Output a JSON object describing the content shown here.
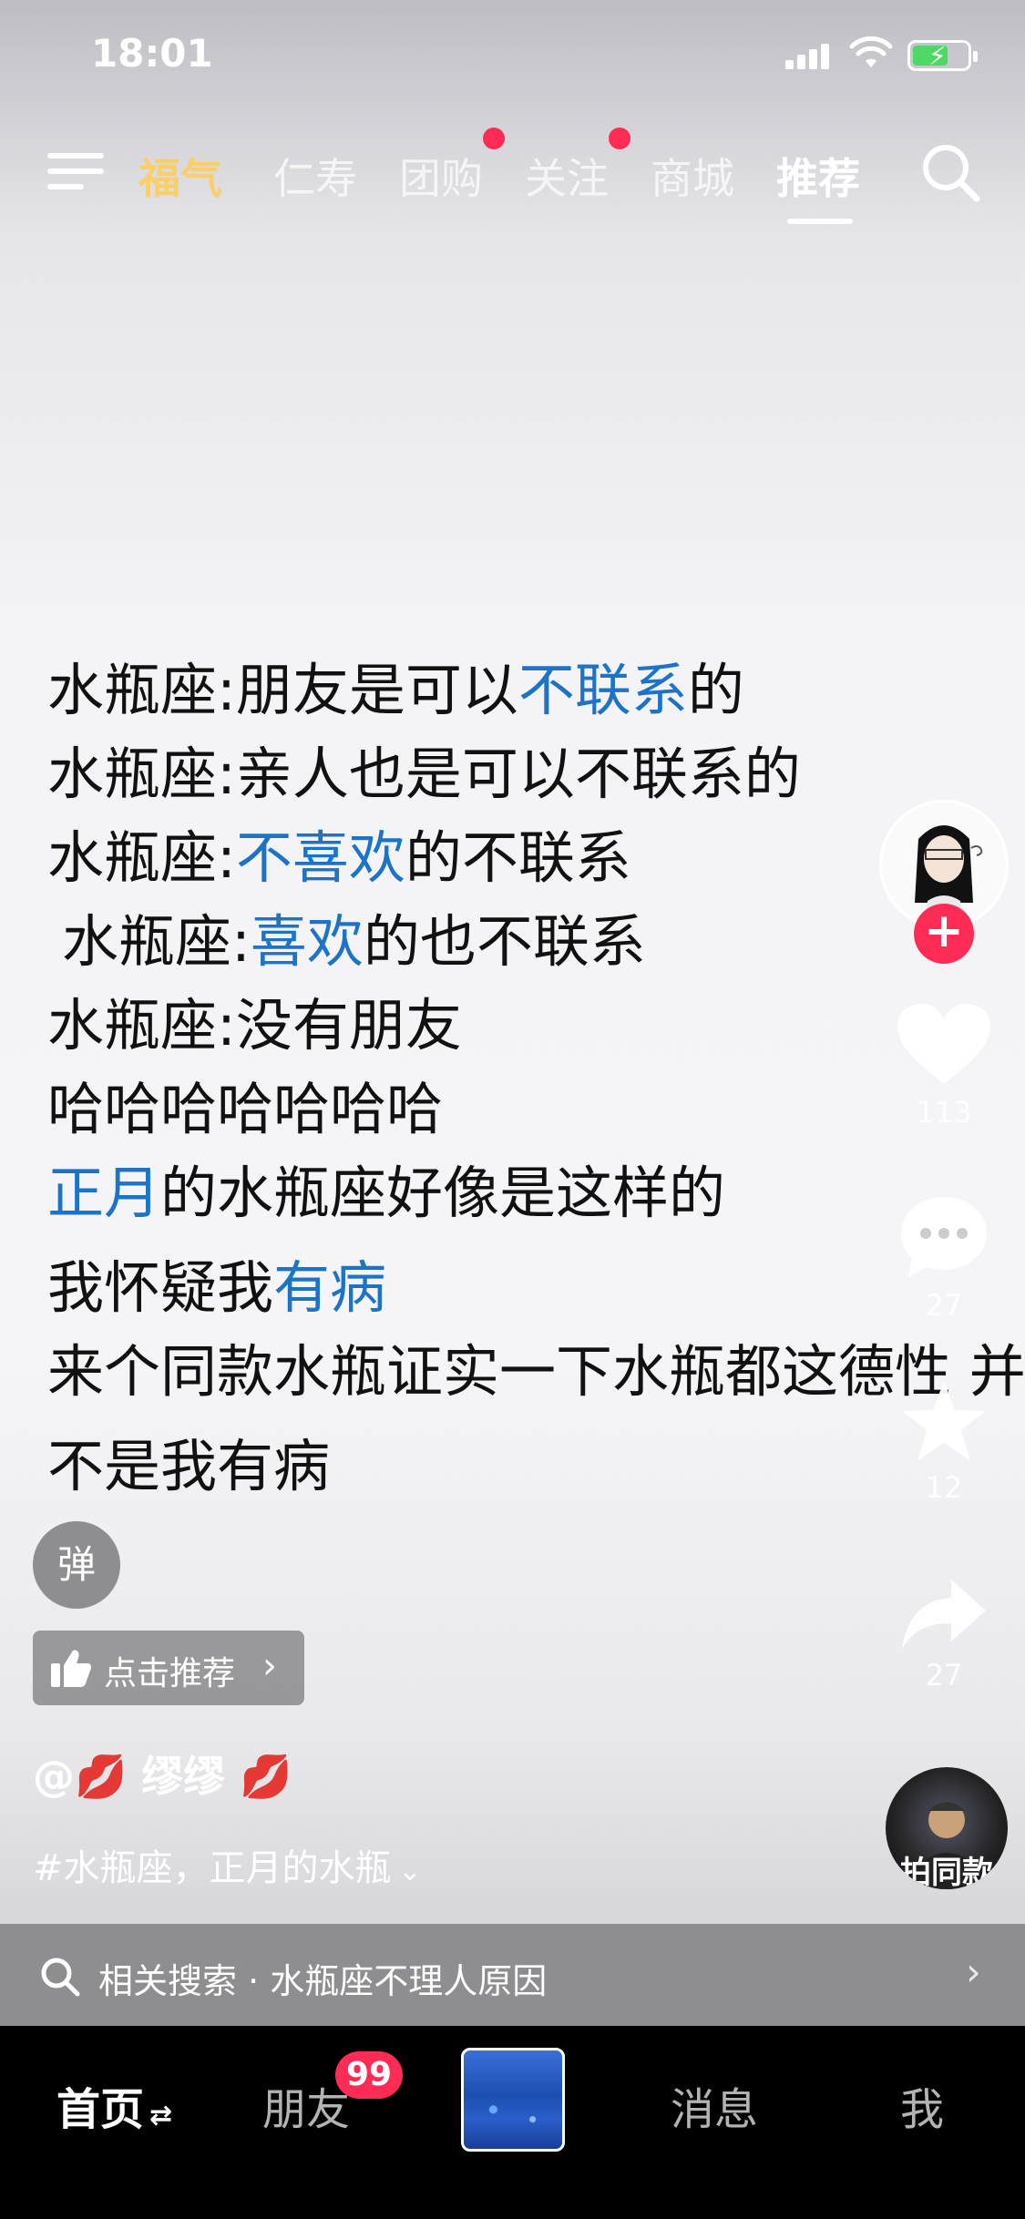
{
  "status": {
    "time": "18:01"
  },
  "top_tabs": [
    {
      "label": "福气"
    },
    {
      "label": "仁寿"
    },
    {
      "label": "团购"
    },
    {
      "label": "关注"
    },
    {
      "label": "商城"
    },
    {
      "label": "推荐"
    }
  ],
  "content": {
    "l1": {
      "a": "水瓶座:朋友是可以",
      "b": "不联系",
      "c": "的"
    },
    "l2": {
      "a": "水瓶座:亲人也是可以不联系的"
    },
    "l3": {
      "a": "水瓶座:",
      "b": "不喜欢",
      "c": "的不联系"
    },
    "l4": {
      "a": "水瓶座:",
      "b": "喜欢",
      "c": "的也不联系"
    },
    "l5": {
      "a": "水瓶座:没有朋友"
    },
    "l6": {
      "a": "哈哈哈哈哈哈哈"
    },
    "l7": {
      "a": "正月",
      "b": "的水瓶座好像是这样的"
    },
    "l8": {
      "a": "我怀疑我",
      "b": "有病"
    },
    "l9": {
      "a": "来个同款水瓶证实一下水瓶都这德性 并"
    },
    "l10": {
      "a": "不是我有病"
    }
  },
  "actions": {
    "like_count": "113",
    "comment_count": "27",
    "favorite_count": "12",
    "share_count": "27",
    "pai_label": "拍同款"
  },
  "overlay": {
    "danmu_label": "弹",
    "recommend_label": "点击推荐",
    "author_name": "@💋 缪缪 💋",
    "hashtags": "#水瓶座，正月的水瓶"
  },
  "related_search": {
    "text": "相关搜索 · 水瓶座不理人原因"
  },
  "bottom_tabs": {
    "home": "首页",
    "friends": "朋友",
    "friends_badge": "99",
    "messages": "消息",
    "me": "我"
  },
  "colors": {
    "accent_red": "#fe2c55",
    "highlight_blue": "#1d73c6",
    "fuqi_gold": "#f8cf6a"
  }
}
